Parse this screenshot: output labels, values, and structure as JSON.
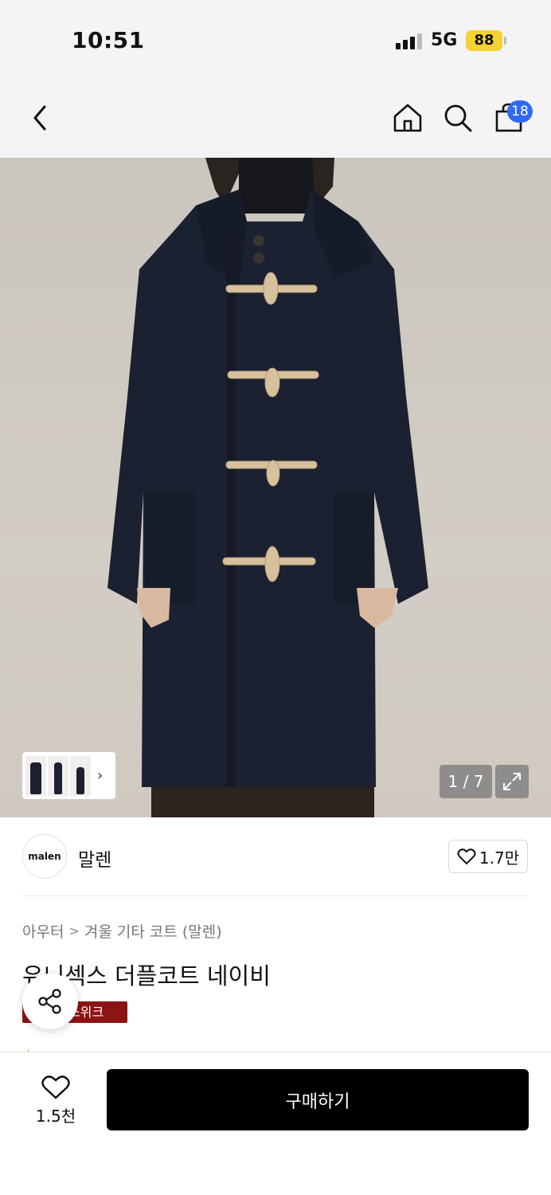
{
  "status_bar": {
    "time": "10:51",
    "network": "5G",
    "battery": "88"
  },
  "nav": {
    "cart_count": "18"
  },
  "gallery": {
    "counter": "1 / 7"
  },
  "brand": {
    "logo_text": "malen",
    "name": "말렌",
    "like_count": "1.7만"
  },
  "product": {
    "breadcrumb_category": "아우터",
    "breadcrumb_sub": "겨울 기타 코트 (말렌)",
    "title": "유니섹스 더플코트 네이비",
    "event_badge": "스위크"
  },
  "bottom_bar": {
    "wish_count": "1.5천",
    "buy_label": "구매하기"
  },
  "colors": {
    "accent_blue": "#2f6bf2",
    "battery_yellow": "#f5d233",
    "event_red": "#8b1414",
    "buy_black": "#000000"
  }
}
